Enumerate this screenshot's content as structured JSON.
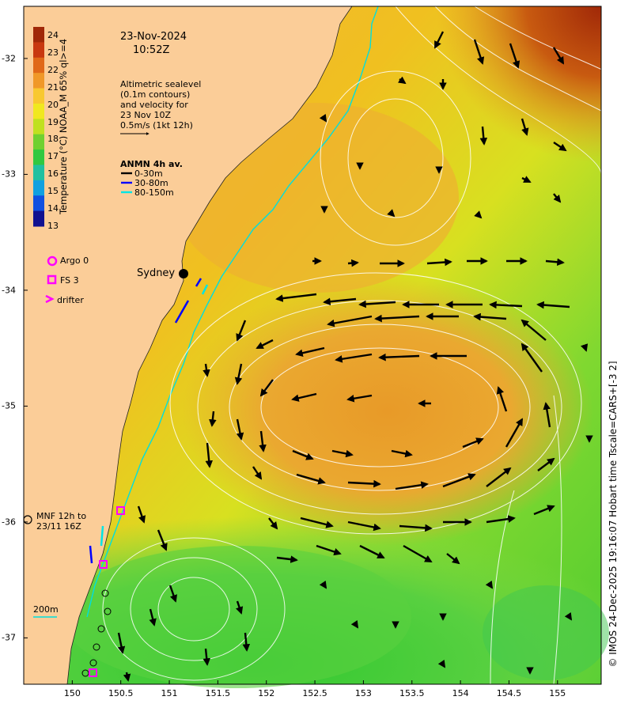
{
  "header": {
    "date": "23-Nov-2024",
    "time": "10:52Z"
  },
  "info": {
    "line1": "Altimetric sealevel",
    "line2": "(0.1m contours)",
    "line3": "and velocity for",
    "line4": "23 Nov 10Z",
    "line5": "0.5m/s (1kt 12h)"
  },
  "anmn": {
    "title": "ANMN 4h av.",
    "items": [
      {
        "label": "0-30m",
        "color": "#000000"
      },
      {
        "label": "30-80m",
        "color": "#0000ff"
      },
      {
        "label": "80-150m",
        "color": "#00e5e5"
      }
    ]
  },
  "colorbar": {
    "label": "Temperature (°C) NOAA_M 65% ql>=4",
    "ticks": [
      "24",
      "23",
      "22",
      "21",
      "20",
      "19",
      "18",
      "17",
      "16",
      "15",
      "14",
      "13"
    ],
    "min": 13,
    "max": 24.5
  },
  "legend": {
    "argo": "Argo 0",
    "fs": "FS 3",
    "drifter": "drifter",
    "argo_color": "#ff00ff"
  },
  "place": {
    "sydney": "Sydney"
  },
  "mnf": {
    "line1": "MNF 12h to",
    "line2": "23/11 16Z"
  },
  "depth_label": "200m",
  "axes": {
    "x_ticks": [
      "150",
      "150.5",
      "151",
      "151.5",
      "152",
      "152.5",
      "153",
      "153.5",
      "154",
      "154.5",
      "155"
    ],
    "y_ticks": [
      "-32",
      "-33",
      "-34",
      "-35",
      "-36",
      "-37"
    ],
    "lon_range": [
      149.5,
      155.45
    ],
    "lat_range": [
      -37.4,
      -31.55
    ]
  },
  "credit": "© IMOS 24-Dec-2025 19:16:07 Hobart time Tscale=CARS+[-3 2]",
  "colors": {
    "land": "#fbcd98",
    "coast_outline": "#222222",
    "isobath": "#00dede"
  }
}
